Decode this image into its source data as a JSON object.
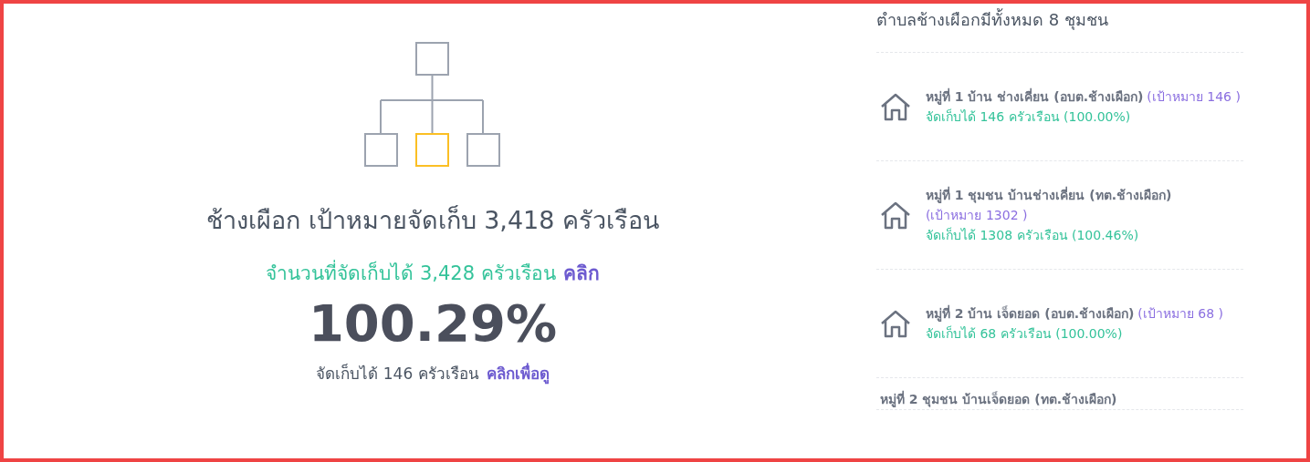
{
  "summary": {
    "title": "ช้างเผือก เป้าหมายจัดเก็บ 3,418 ครัวเรือน",
    "collected": "จำนวนที่จัดเก็บได้ 3,428 ครัวเรือน",
    "collected_link": "คลิก",
    "percent": "100.29%",
    "sub": "จัดเก็บได้ 146 ครัวเรือน",
    "sub_link": "คลิกเพื่อดู"
  },
  "communities": {
    "heading": "ตำบลช้างเผือกมีทั้งหมด 8 ชุมชน",
    "items": [
      {
        "name": "หมู่ที่ 1 บ้าน ช่างเคี่ยน (อบต.ช้างเผือก)",
        "target": "(เป้าหมาย 146 )",
        "collected": "จัดเก็บได้ 146 ครัวเรือน (100.00%)"
      },
      {
        "name": "หมู่ที่ 1 ชุมชน บ้านช่างเคี่ยน (ทต.ช้างเผือก)",
        "target": "(เป้าหมาย 1302 )",
        "collected": "จัดเก็บได้ 1308 ครัวเรือน (100.46%)"
      },
      {
        "name": "หมู่ที่ 2 บ้าน เจ็ดยอด (อบต.ช้างเผือก)",
        "target": "(เป้าหมาย 68 )",
        "collected": "จัดเก็บได้ 68 ครัวเรือน (100.00%)"
      },
      {
        "name": "หมู่ที่ 2 ชุมชน บ้านเจ็ดยอด (ทต.ช้างเผือก)"
      }
    ]
  }
}
